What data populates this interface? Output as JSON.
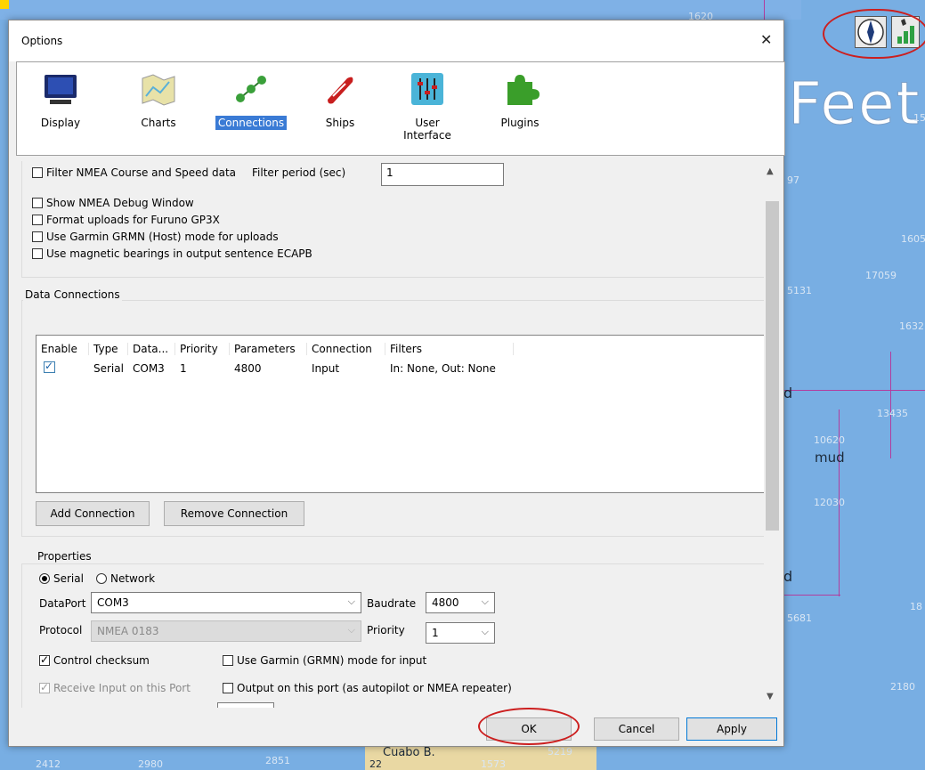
{
  "chart_bg": {
    "big_text": "Feet",
    "numbers": [
      "1620",
      "1605",
      "5131",
      "17059",
      "1632",
      "13435",
      "10620",
      "12030",
      "5681",
      "18",
      "2180",
      "2412",
      "2980",
      "2851",
      "5219",
      "22",
      "1573",
      "97",
      "15"
    ],
    "mud_label": "mud",
    "d_labels": [
      "d",
      "d"
    ],
    "place_label": "Cuabo B."
  },
  "dialog": {
    "title": "Options",
    "close_symbol": "✕"
  },
  "toolbar": {
    "items": [
      {
        "label": "Display",
        "icon": "monitor-icon"
      },
      {
        "label": "Charts",
        "icon": "map-icon"
      },
      {
        "label": "Connections",
        "icon": "connections-icon",
        "selected": true
      },
      {
        "label": "Ships",
        "icon": "ship-icon"
      },
      {
        "label": "User Interface",
        "icon": "sliders-icon"
      },
      {
        "label": "Plugins",
        "icon": "puzzle-icon"
      }
    ]
  },
  "nmea": {
    "filter_label": "Filter NMEA Course and Speed data",
    "filter_period_label": "Filter period (sec)",
    "filter_period_value": "1",
    "debug_label": "Show NMEA Debug Window",
    "furuno_label": "Format uploads for Furuno GP3X",
    "garmin_label": "Use Garmin GRMN (Host) mode for uploads",
    "magnetic_label": "Use magnetic bearings in output sentence ECAPB"
  },
  "data_connections": {
    "group_label": "Data Connections",
    "columns": [
      "Enable",
      "Type",
      "Data...",
      "Priority",
      "Parameters",
      "Connection",
      "Filters"
    ],
    "rows": [
      {
        "enabled": true,
        "type": "Serial",
        "data": "COM3",
        "priority": "1",
        "parameters": "4800",
        "connection": "Input",
        "filters": "In: None, Out: None"
      }
    ],
    "add_label": "Add Connection",
    "remove_label": "Remove Connection"
  },
  "properties": {
    "group_label": "Properties",
    "serial_label": "Serial",
    "network_label": "Network",
    "dataport_label": "DataPort",
    "dataport_value": "COM3",
    "baudrate_label": "Baudrate",
    "baudrate_value": "4800",
    "protocol_label": "Protocol",
    "protocol_value": "NMEA 0183",
    "priority_label": "Priority",
    "priority_value": "1",
    "checksum_label": "Control checksum",
    "garmin_input_label": "Use Garmin (GRMN) mode for input",
    "receive_label": "Receive Input on this Port",
    "output_label": "Output on this port (as autopilot or NMEA repeater)"
  },
  "footer": {
    "ok_label": "OK",
    "cancel_label": "Cancel",
    "apply_label": "Apply"
  }
}
